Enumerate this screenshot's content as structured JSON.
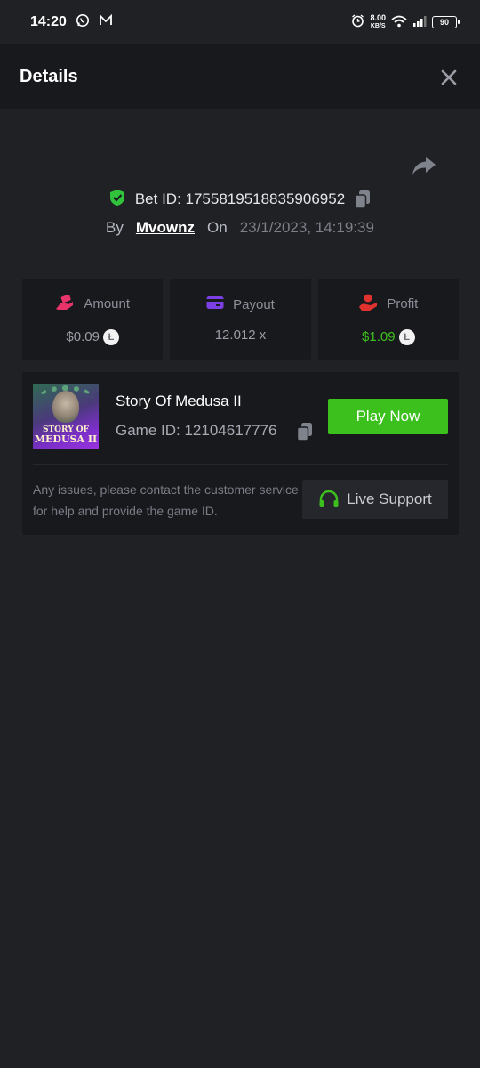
{
  "status_bar": {
    "time": "14:20",
    "net_speed": "8.00",
    "net_unit": "KB/S",
    "battery": "90"
  },
  "header": {
    "title": "Details"
  },
  "bet": {
    "id_label": "Bet ID: 1755819518835906952",
    "by_label": "By",
    "username": "Mvownz",
    "on_label": "On",
    "date": "23/1/2023, 14:19:39"
  },
  "stats": {
    "amount": {
      "label": "Amount",
      "value": "$0.09",
      "icon": "cash-hand-icon"
    },
    "payout": {
      "label": "Payout",
      "value": "12.012 x",
      "icon": "credit-card-icon"
    },
    "profit": {
      "label": "Profit",
      "value": "$1.09",
      "icon": "money-hand-icon"
    },
    "coin_symbol": "Ł"
  },
  "game": {
    "name": "Story Of Medusa II",
    "id_label": "Game ID: 12104617776",
    "thumb_text_line1": "STORY OF",
    "thumb_text_line2": "MEDUSA II",
    "play_label": "Play Now"
  },
  "support": {
    "text": "Any issues, please contact the customer service for help and provide the game ID.",
    "button_label": "Live Support"
  },
  "colors": {
    "background": "#202125",
    "panel": "#18191d",
    "accent_green": "#3bc01e",
    "amount_pink": "#e8336b",
    "payout_purple": "#7b3fe4",
    "profit_red": "#e0332f"
  }
}
